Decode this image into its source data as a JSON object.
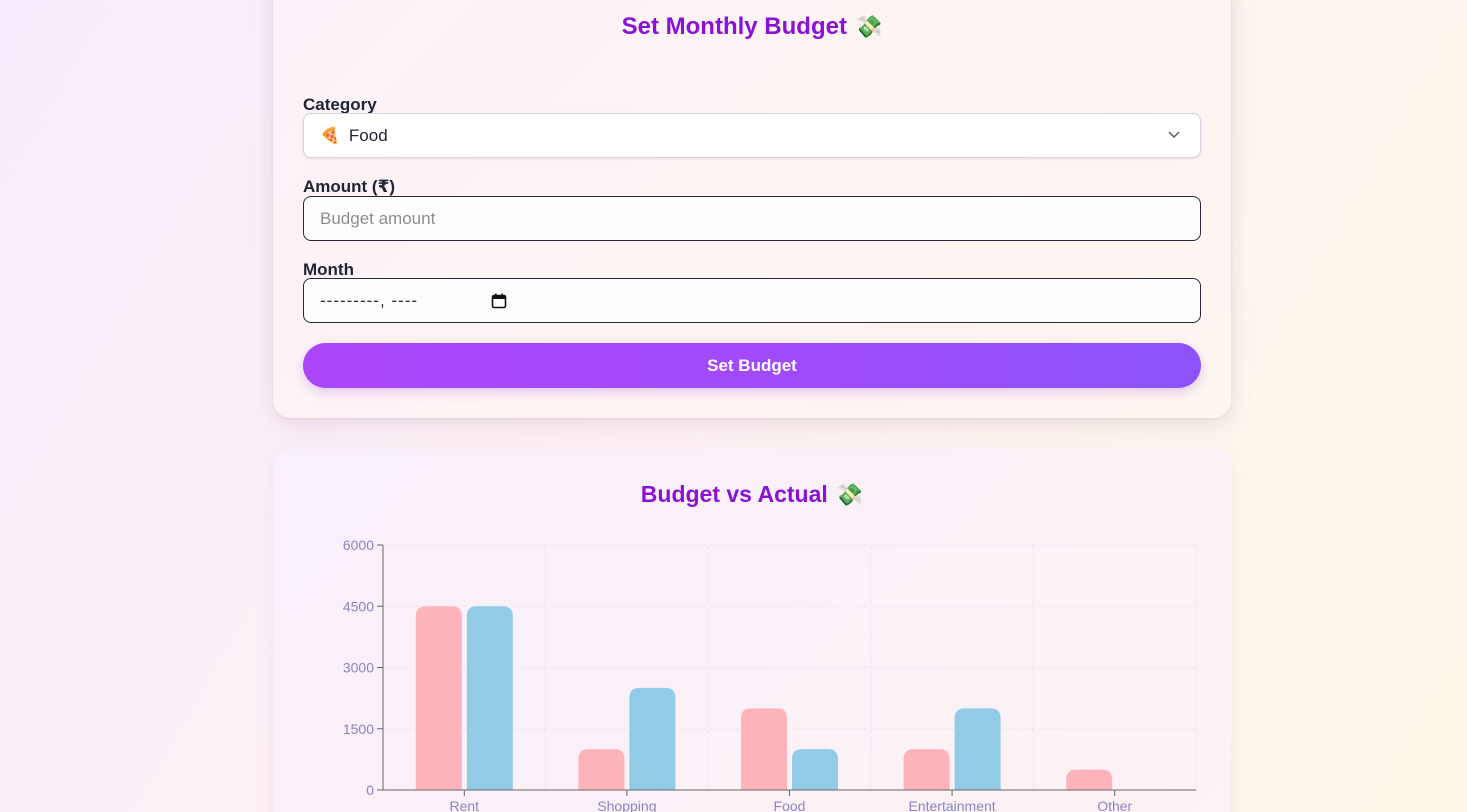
{
  "budget_form": {
    "title": "Set Monthly Budget",
    "title_emoji": "💸",
    "category_label": "Category",
    "category_selected": "Food",
    "category_emoji": "🍕",
    "amount_label": "Amount (₹)",
    "amount_placeholder": "Budget amount",
    "amount_value": "",
    "month_label": "Month",
    "month_value": "---------, ----",
    "submit_label": "Set Budget"
  },
  "chart_section": {
    "title": "Budget vs Actual",
    "title_emoji": "💸"
  },
  "colors": {
    "title": "#8a12d6",
    "budget_bar": "#ffb3ba",
    "actual_bar": "#92cbe6",
    "button_start": "#aa45f8",
    "button_end": "#8c53f9",
    "axis_text": "#8a86c2"
  },
  "chart_data": {
    "type": "bar",
    "title": "Budget vs Actual",
    "categories": [
      "Rent",
      "Shopping",
      "Food",
      "Entertainment",
      "Other"
    ],
    "series": [
      {
        "values": [
          4500,
          1000,
          2000,
          1000,
          500
        ]
      },
      {
        "values": [
          4500,
          2500,
          1000,
          2000,
          0
        ]
      }
    ],
    "ylim": [
      0,
      6000
    ],
    "yticks": [
      0,
      1500,
      3000,
      4500,
      6000
    ],
    "grid": true
  }
}
